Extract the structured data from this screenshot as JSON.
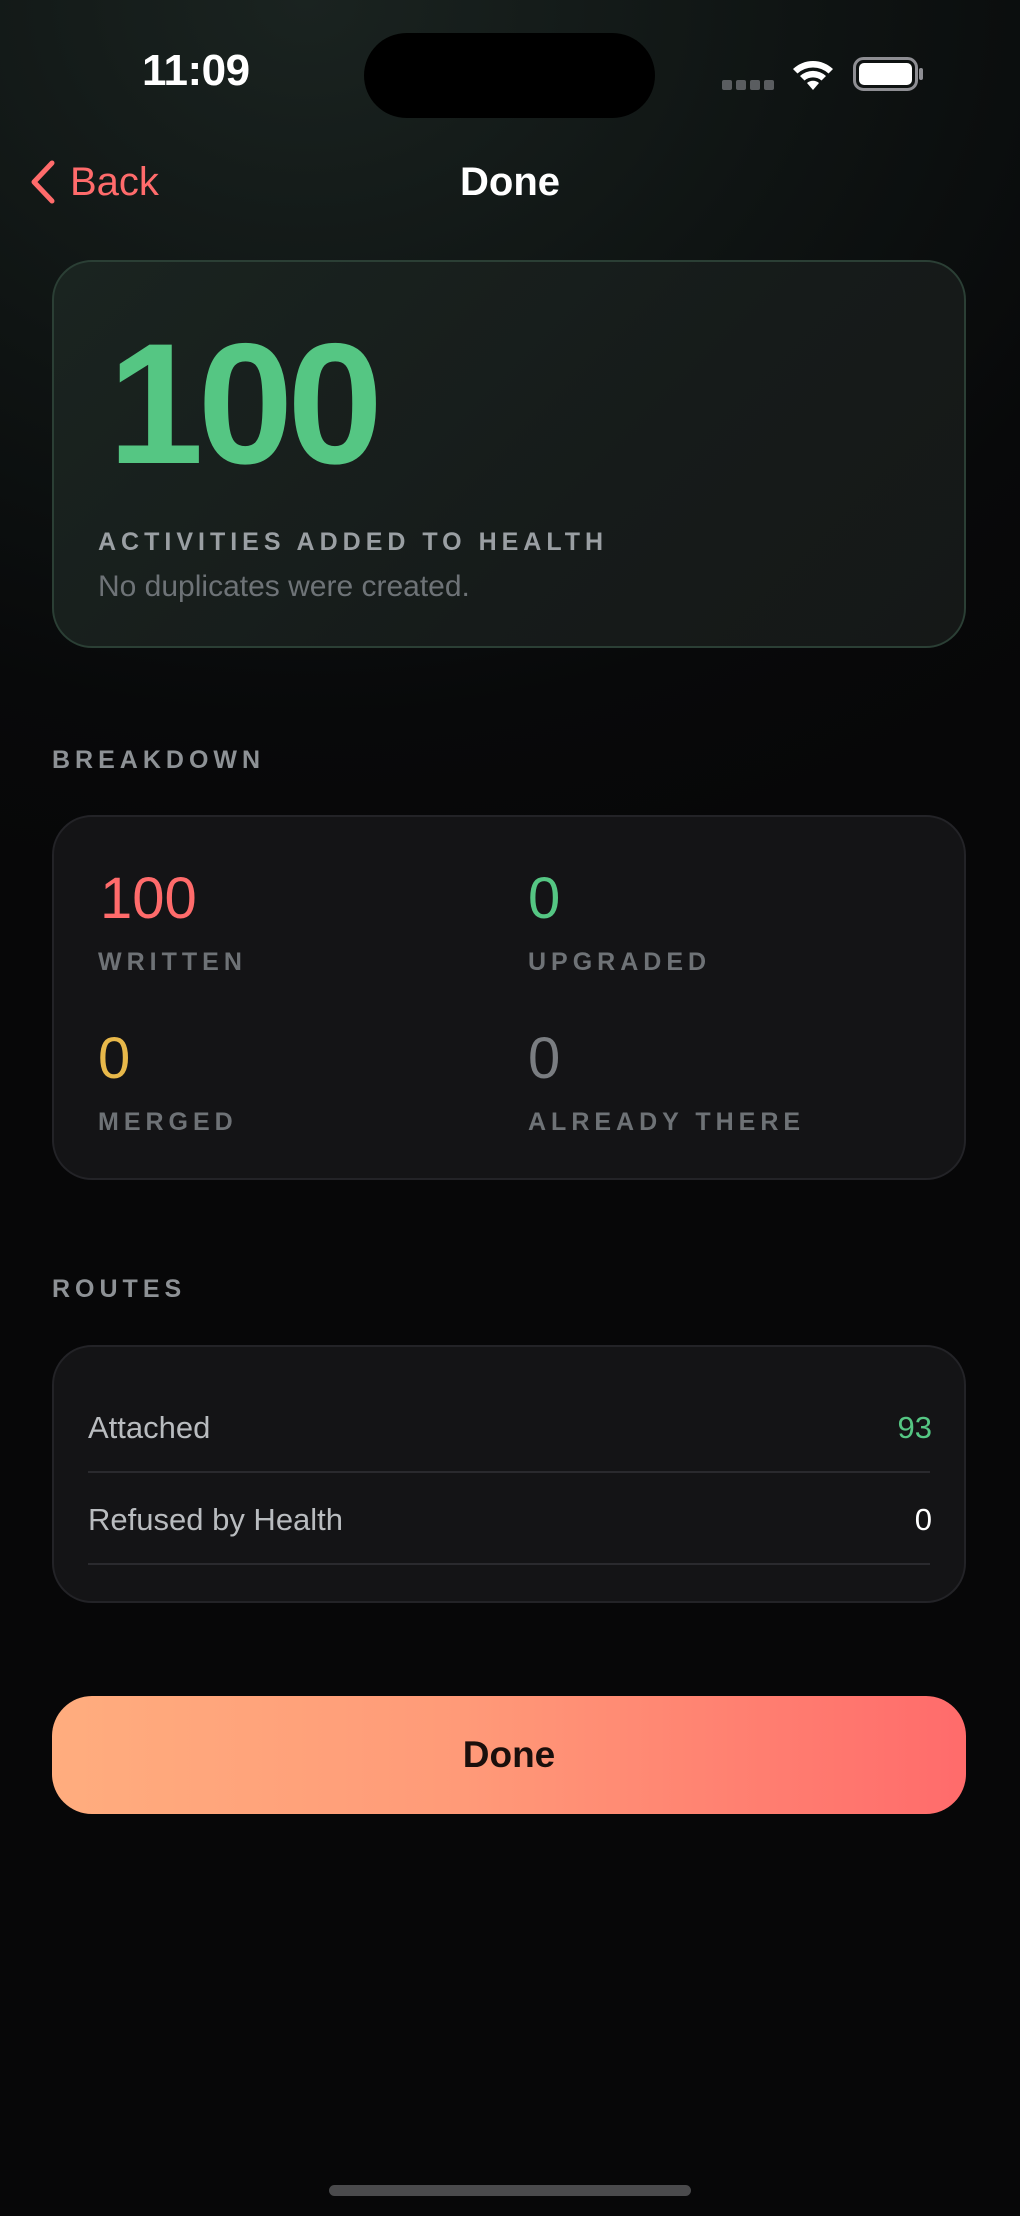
{
  "status_bar": {
    "time": "11:09"
  },
  "nav": {
    "back_label": "Back",
    "title": "Done"
  },
  "hero": {
    "count": "100",
    "label": "ACTIVITIES ADDED TO HEALTH",
    "subtitle": "No duplicates were created."
  },
  "breakdown": {
    "heading": "BREAKDOWN",
    "stats": [
      {
        "value": "100",
        "label": "WRITTEN",
        "color": "#ff6b6b"
      },
      {
        "value": "0",
        "label": "UPGRADED",
        "color": "#55c683"
      },
      {
        "value": "0",
        "label": "MERGED",
        "color": "#e8b84a"
      },
      {
        "value": "0",
        "label": "ALREADY THERE",
        "color": "#7a7d81"
      }
    ]
  },
  "routes": {
    "heading": "ROUTES",
    "rows": [
      {
        "label": "Attached",
        "value": "93",
        "color": "#55c683"
      },
      {
        "label": "Refused by Health",
        "value": "0",
        "color": "#ffffff"
      }
    ]
  },
  "done_button": {
    "label": "Done"
  },
  "colors": {
    "accent": "#ff6b6b",
    "success": "#55c683",
    "warning": "#e8b84a"
  }
}
